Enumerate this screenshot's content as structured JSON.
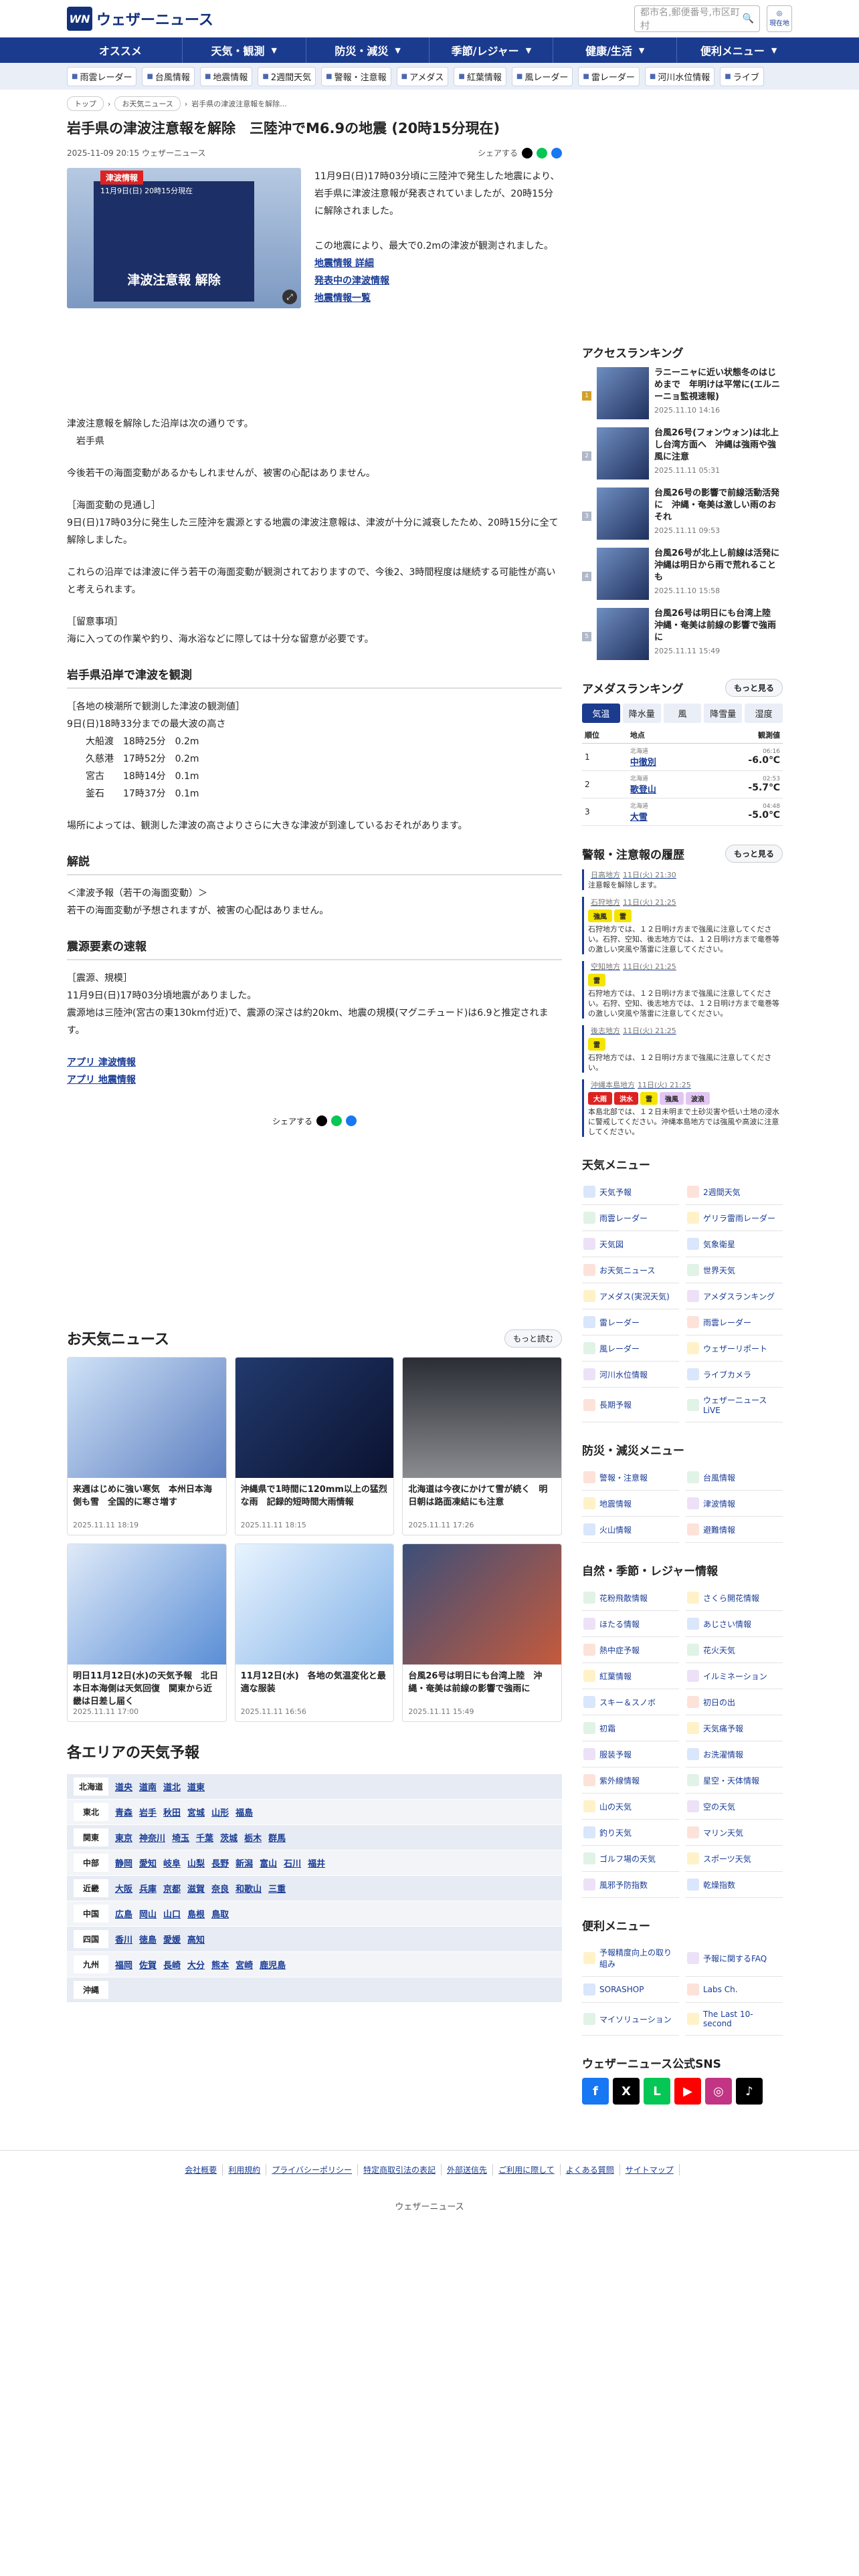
{
  "header": {
    "logo_text": "ウェザーニュース",
    "logo_mark": "WN",
    "search_placeholder": "都市名,郵便番号,市区町村",
    "location_label": "現在地"
  },
  "gnav": [
    "オススメ",
    "天気・観測",
    "防災・減災",
    "季節/レジャー",
    "健康/生活",
    "便利メニュー"
  ],
  "subnav": [
    "雨雲レーダー",
    "台風情報",
    "地震情報",
    "2週間天気",
    "警報・注意報",
    "アメダス",
    "紅葉情報",
    "風レーダー",
    "雷レーダー",
    "河川水位情報",
    "ライブ"
  ],
  "breadcrumb": [
    "トップ",
    "お天気ニュース",
    "岩手県の津波注意報を解除..."
  ],
  "article": {
    "title": "岩手県の津波注意報を解除　三陸沖でM6.9の地震 (20時15分現在)",
    "date": "2025-11-09 20:15 ウェザーニュース",
    "share_label": "シェアする",
    "hero_badge": "津波情報",
    "hero_sub": "11月9日(日) 20時15分現在",
    "hero_caption": "津波注意報 解除",
    "lead": "11月9日(日)17時03分頃に三陸沖で発生した地震により、岩手県に津波注意報が発表されていましたが、20時15分に解除されました。",
    "lead2": "この地震により、最大で0.2mの津波が観測されました。",
    "lead_links": [
      "地震情報 詳細",
      "発表中の津波情報",
      "地震情報一覧"
    ],
    "p1": "津波注意報を解除した沿岸は次の通りです。\n　岩手県",
    "p2": "今後若干の海面変動があるかもしれませんが、被害の心配はありません。",
    "p3": "［海面変動の見通し］\n9日(日)17時03分に発生した三陸沖を震源とする地震の津波注意報は、津波が十分に減衰したため、20時15分に全て解除しました。",
    "p4": "これらの沿岸では津波に伴う若干の海面変動が観測されておりますので、今後2、3時間程度は継続する可能性が高いと考えられます。",
    "p5": "［留意事項］\n海に入っての作業や釣り、海水浴などに際しては十分な留意が必要です。",
    "h_obs": "岩手県沿岸で津波を観測",
    "obs": "［各地の検潮所で観測した津波の観測値］\n9日(日)18時33分までの最大波の高さ\n　　大船渡　18時25分　0.2m\n　　久慈港　17時52分　0.2m\n　　宮古　　18時14分　0.1m\n　　釜石　　17時37分　0.1m",
    "obs2": "場所によっては、観測した津波の高さよりさらに大きな津波が到達しているおそれがあります。",
    "h_exp": "解説",
    "exp": "＜津波予報（若干の海面変動）＞\n若干の海面変動が予想されますが、被害の心配はありません。",
    "h_eq": "震源要素の速報",
    "eq": "［震源、規模］\n11月9日(日)17時03分頃地震がありました。\n震源地は三陸沖(宮古の東130km付近)で、震源の深さは約20km、地震の規模(マグニチュード)は6.9と推定されます。",
    "app_links": [
      "アプリ 津波情報",
      "アプリ 地震情報"
    ]
  },
  "news": {
    "title": "お天気ニュース",
    "more": "もっと読む",
    "items": [
      {
        "t": "来週はじめに強い寒気　本州日本海側も雪　全国的に寒さ増す",
        "d": "2025.11.11 18:19"
      },
      {
        "t": "沖縄県で1時間に120mm以上の猛烈な雨　記録的短時間大雨情報",
        "d": "2025.11.11 18:15"
      },
      {
        "t": "北海道は今夜にかけて雪が続く　明日朝は路面凍結にも注意",
        "d": "2025.11.11 17:26"
      },
      {
        "t": "明日11月12日(水)の天気予報　北日本日本海側は天気回復　関東から近畿は日差し届く",
        "d": "2025.11.11 17:00"
      },
      {
        "t": "11月12日(水)　各地の気温変化と最適な服装",
        "d": "2025.11.11 16:56"
      },
      {
        "t": "台風26号は明日にも台湾上陸　沖縄・奄美は前線の影響で強雨に",
        "d": "2025.11.11 15:49"
      }
    ]
  },
  "areas": {
    "title": "各エリアの天気予報",
    "rows": [
      {
        "r": "北海道",
        "c": [
          "道央",
          "道南",
          "道北",
          "道東"
        ]
      },
      {
        "r": "東北",
        "c": [
          "青森",
          "岩手",
          "秋田",
          "宮城",
          "山形",
          "福島"
        ]
      },
      {
        "r": "関東",
        "c": [
          "東京",
          "神奈川",
          "埼玉",
          "千葉",
          "茨城",
          "栃木",
          "群馬"
        ]
      },
      {
        "r": "中部",
        "c": [
          "静岡",
          "愛知",
          "岐阜",
          "山梨",
          "長野",
          "新潟",
          "富山",
          "石川",
          "福井"
        ]
      },
      {
        "r": "近畿",
        "c": [
          "大阪",
          "兵庫",
          "京都",
          "滋賀",
          "奈良",
          "和歌山",
          "三重"
        ]
      },
      {
        "r": "中国",
        "c": [
          "広島",
          "岡山",
          "山口",
          "島根",
          "鳥取"
        ]
      },
      {
        "r": "四国",
        "c": [
          "香川",
          "徳島",
          "愛媛",
          "高知"
        ]
      },
      {
        "r": "九州",
        "c": [
          "福岡",
          "佐賀",
          "長崎",
          "大分",
          "熊本",
          "宮崎",
          "鹿児島"
        ]
      },
      {
        "r": "沖縄",
        "c": []
      }
    ]
  },
  "access": {
    "title": "アクセスランキング",
    "items": [
      {
        "t": "ラニーニャに近い状態冬のはじめまで　年明けは平常に(エルニーニョ監視速報)",
        "d": "2025.11.10 14:16"
      },
      {
        "t": "台風26号(フォンウォン)は北上し台湾方面へ　沖縄は強雨や強風に注意",
        "d": "2025.11.11 05:31"
      },
      {
        "t": "台風26号の影響で前線活動活発に　沖縄・奄美は激しい雨のおそれ",
        "d": "2025.11.11 09:53"
      },
      {
        "t": "台風26号が北上し前線は活発に　沖縄は明日から雨で荒れることも",
        "d": "2025.11.10 15:58"
      },
      {
        "t": "台風26号は明日にも台湾上陸　沖縄・奄美は前線の影響で強雨に",
        "d": "2025.11.11 15:49"
      }
    ]
  },
  "amedas": {
    "title": "アメダスランキング",
    "more": "もっと見る",
    "tabs": [
      "気温",
      "降水量",
      "風",
      "降雪量",
      "湿度"
    ],
    "cols": [
      "順位",
      "地点",
      "観測値"
    ],
    "rows": [
      {
        "n": "1",
        "pref": "北海道",
        "s": "中徹別",
        "t": "06:16",
        "v": "-6.0℃"
      },
      {
        "n": "2",
        "pref": "北海道",
        "s": "歌登山",
        "t": "02:53",
        "v": "-5.7℃"
      },
      {
        "n": "3",
        "pref": "北海道",
        "s": "大雪",
        "t": "04:48",
        "v": "-5.0℃"
      }
    ]
  },
  "warn": {
    "title": "警報・注意報の履歴",
    "more": "もっと見る",
    "items": [
      {
        "h": "日高地方",
        "d": "11日(火) 21:30",
        "tags": [],
        "tx": "注意報を解除します。"
      },
      {
        "h": "石狩地方",
        "d": "11日(火) 21:25",
        "tags": [
          "強風",
          "雷"
        ],
        "tx": "石狩地方では、１２日明け方まで強風に注意してください。石狩、空知、後志地方では、１２日明け方まで竜巻等の激しい突風や落雷に注意してください。"
      },
      {
        "h": "空知地方",
        "d": "11日(火) 21:25",
        "tags": [
          "雷"
        ],
        "tx": "石狩地方では、１２日明け方まで強風に注意してください。石狩、空知、後志地方では、１２日明け方まで竜巻等の激しい突風や落雷に注意してください。"
      },
      {
        "h": "後志地方",
        "d": "11日(火) 21:25",
        "tags": [
          "雷"
        ],
        "tx": "石狩地方では、１２日明け方まで強風に注意してください。"
      },
      {
        "h": "沖縄本島地方",
        "d": "11日(火) 21:25",
        "tags": [
          "大雨",
          "洪水",
          "雷",
          "強風",
          "波浪"
        ],
        "tx": "本島北部では、１２日未明まで土砂災害や低い土地の浸水に警戒してください。沖縄本島地方では強風や高波に注意してください。"
      }
    ]
  },
  "menus": [
    {
      "title": "天気メニュー",
      "items": [
        "天気予報",
        "2週間天気",
        "雨雲レーダー",
        "ゲリラ雷雨レーダー",
        "天気図",
        "気象衛星",
        "お天気ニュース",
        "世界天気",
        "アメダス(実況天気)",
        "アメダスランキング",
        "雷レーダー",
        "雨雲レーダー",
        "風レーダー",
        "ウェザーリポート",
        "河川水位情報",
        "ライブカメラ",
        "長期予報",
        "ウェザーニュースLiVE"
      ]
    },
    {
      "title": "防災・減災メニュー",
      "items": [
        "警報・注意報",
        "台風情報",
        "地震情報",
        "津波情報",
        "火山情報",
        "避難情報"
      ]
    },
    {
      "title": "自然・季節・レジャー情報",
      "items": [
        "花粉飛散情報",
        "さくら開花情報",
        "ほたる情報",
        "あじさい情報",
        "熱中症予報",
        "花火天気",
        "紅葉情報",
        "イルミネーション",
        "スキー＆スノボ",
        "初日の出",
        "初霜",
        "天気痛予報",
        "服装予報",
        "お洗濯情報",
        "紫外線情報",
        "星空・天体情報",
        "山の天気",
        "空の天気",
        "釣り天気",
        "マリン天気",
        "ゴルフ場の天気",
        "スポーツ天気",
        "風邪予防指数",
        "乾燥指数"
      ]
    },
    {
      "title": "便利メニュー",
      "items": [
        "予報精度向上の取り組み",
        "予報に関するFAQ",
        "SORASHOP",
        "Labs Ch.",
        "マイソリューション",
        "The Last 10-second"
      ]
    }
  ],
  "sns": {
    "title": "ウェザーニュース公式SNS",
    "items": [
      "f",
      "X",
      "L",
      "▶",
      "◎",
      "♪"
    ],
    "colors": [
      "#1877f2",
      "#000000",
      "#06c755",
      "#ff0000",
      "#c13584",
      "#000000"
    ]
  },
  "footer": {
    "links": [
      "会社概要",
      "利用規約",
      "プライバシーポリシー",
      "特定商取引法の表記",
      "外部送信先",
      "ご利用に際して",
      "よくある質問",
      "サイトマップ"
    ],
    "copy": "ウェザーニュース"
  }
}
